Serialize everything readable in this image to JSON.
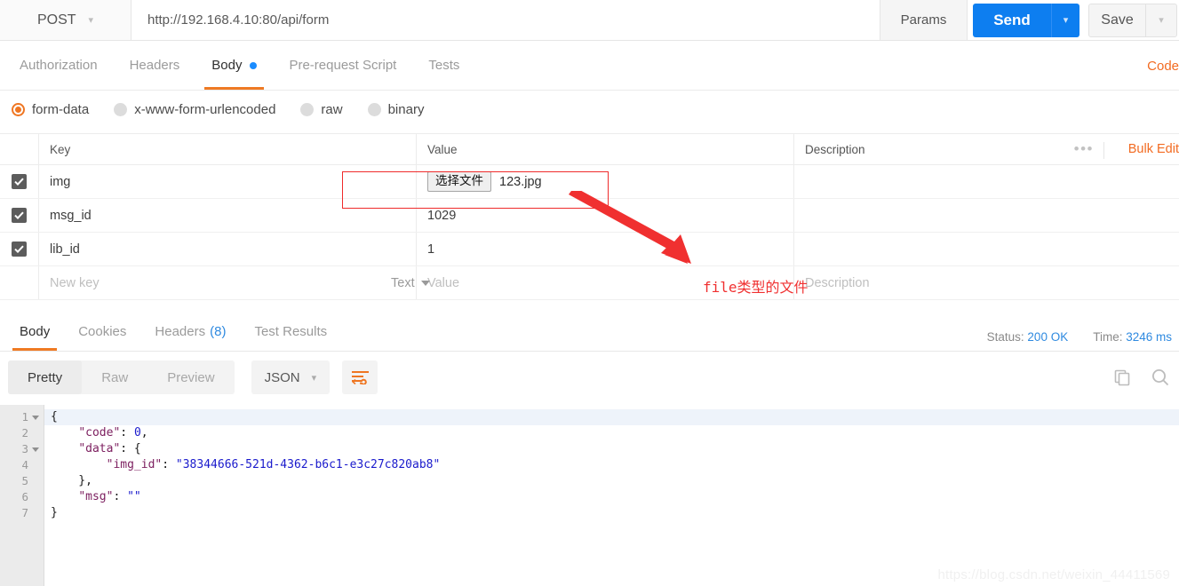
{
  "urlbar": {
    "method": "POST",
    "method_caret": "chevron-down",
    "url": "http://192.168.4.10:80/api/form",
    "params_label": "Params",
    "send_label": "Send",
    "save_label": "Save"
  },
  "request_tabs": {
    "items": [
      {
        "label": "Authorization",
        "active": false,
        "dot": false
      },
      {
        "label": "Headers",
        "active": false,
        "dot": false
      },
      {
        "label": "Body",
        "active": true,
        "dot": true
      },
      {
        "label": "Pre-request Script",
        "active": false,
        "dot": false
      },
      {
        "label": "Tests",
        "active": false,
        "dot": false
      }
    ],
    "code_link": "Code"
  },
  "body_types": [
    {
      "label": "form-data",
      "selected": true
    },
    {
      "label": "x-www-form-urlencoded",
      "selected": false
    },
    {
      "label": "raw",
      "selected": false
    },
    {
      "label": "binary",
      "selected": false
    }
  ],
  "kv_table": {
    "headers": [
      "Key",
      "Value",
      "Description"
    ],
    "bulk_edit_label": "Bulk Edit",
    "rows": [
      {
        "checked": true,
        "key": "img",
        "value_type": "file",
        "file_button": "选择文件",
        "file_name": "123.jpg",
        "description": ""
      },
      {
        "checked": true,
        "key": "msg_id",
        "value": "1029",
        "value_type": "text",
        "description": ""
      },
      {
        "checked": true,
        "key": "lib_id",
        "value": "1",
        "value_type": "text",
        "description": ""
      }
    ],
    "new_row": {
      "key_placeholder": "New key",
      "type_label": "Text",
      "value_placeholder": "Value",
      "description_placeholder": "Description"
    }
  },
  "annotation": {
    "text": "file类型的文件",
    "color": "#f03030"
  },
  "response_tabs": {
    "items": [
      {
        "label": "Body",
        "count": "",
        "active": true
      },
      {
        "label": "Cookies",
        "count": "",
        "active": false
      },
      {
        "label": "Headers",
        "count": "(8)",
        "active": false
      },
      {
        "label": "Test Results",
        "count": "",
        "active": false
      }
    ],
    "status_label": "Status:",
    "status_value": "200 OK",
    "time_label": "Time:",
    "time_value": "3246 ms"
  },
  "response_tools": {
    "views": [
      {
        "label": "Pretty",
        "active": true
      },
      {
        "label": "Raw",
        "active": false
      },
      {
        "label": "Preview",
        "active": false
      }
    ],
    "format": "JSON",
    "wrap_icon": "word-wrap-icon",
    "copy_icon": "copy-icon",
    "search_icon": "search-icon"
  },
  "response_body": {
    "line_numbers": [
      "1",
      "2",
      "3",
      "4",
      "5",
      "6",
      "7"
    ],
    "fold_lines": [
      "1",
      "3"
    ],
    "lines": [
      [
        {
          "t": "{",
          "c": "pun"
        }
      ],
      [
        {
          "t": "    ",
          "c": "pun"
        },
        {
          "t": "\"code\"",
          "c": "key"
        },
        {
          "t": ": ",
          "c": "pun"
        },
        {
          "t": "0",
          "c": "num"
        },
        {
          "t": ",",
          "c": "pun"
        }
      ],
      [
        {
          "t": "    ",
          "c": "pun"
        },
        {
          "t": "\"data\"",
          "c": "key"
        },
        {
          "t": ": {",
          "c": "pun"
        }
      ],
      [
        {
          "t": "        ",
          "c": "pun"
        },
        {
          "t": "\"img_id\"",
          "c": "key"
        },
        {
          "t": ": ",
          "c": "pun"
        },
        {
          "t": "\"38344666-521d-4362-b6c1-e3c27c820ab8\"",
          "c": "str"
        }
      ],
      [
        {
          "t": "    },",
          "c": "pun"
        }
      ],
      [
        {
          "t": "    ",
          "c": "pun"
        },
        {
          "t": "\"msg\"",
          "c": "key"
        },
        {
          "t": ": ",
          "c": "pun"
        },
        {
          "t": "\"\"",
          "c": "str"
        }
      ],
      [
        {
          "t": "}",
          "c": "pun"
        }
      ]
    ],
    "raw_text": "{\n    \"code\": 0,\n    \"data\": {\n        \"img_id\": \"38344666-521d-4362-b6c1-e3c27c820ab8\"\n    },\n    \"msg\": \"\"\n}"
  },
  "watermark": "https://blog.csdn.net/weixin_44411569"
}
